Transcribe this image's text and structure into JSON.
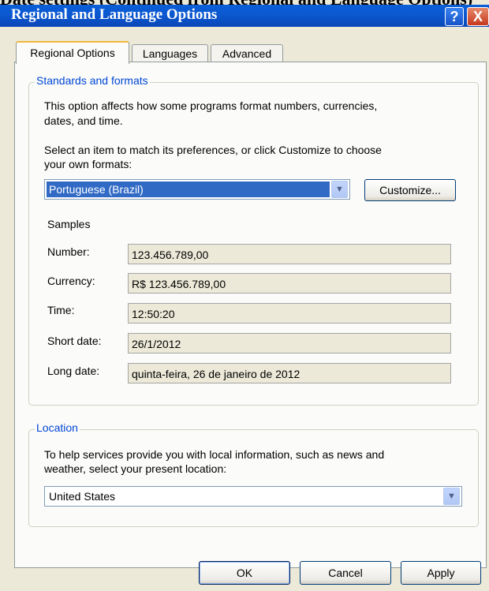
{
  "window": {
    "title": "Regional and Language Options",
    "background_text": "Date settings (Continued from Regional and Language Options)",
    "help_glyph": "?",
    "close_glyph": "X"
  },
  "tabs": [
    {
      "label": "Regional Options",
      "active": true
    },
    {
      "label": "Languages",
      "active": false
    },
    {
      "label": "Advanced",
      "active": false
    }
  ],
  "standards": {
    "legend": "Standards and formats",
    "description_1": "This option affects how some programs format numbers, currencies,",
    "description_2": "dates, and time.",
    "select_prompt_1": "Select an item to match its preferences, or click Customize to choose",
    "select_prompt_2": "your own formats:",
    "selected_format": "Portuguese (Brazil)",
    "customize_label": "Customize...",
    "samples_heading": "Samples",
    "samples": [
      {
        "label": "Number:",
        "value": "123.456.789,00"
      },
      {
        "label": "Currency:",
        "value": "R$ 123.456.789,00"
      },
      {
        "label": "Time:",
        "value": "12:50:20"
      },
      {
        "label": "Short date:",
        "value": "26/1/2012"
      },
      {
        "label": "Long date:",
        "value": "quinta-feira, 26 de janeiro de 2012"
      }
    ]
  },
  "location": {
    "legend": "Location",
    "description_1": "To help services provide you with local information, such as news and",
    "description_2": "weather, select your present location:",
    "selected_location": "United States"
  },
  "buttons": {
    "ok": "OK",
    "cancel": "Cancel",
    "apply": "Apply"
  },
  "colors": {
    "titlebar": "#0a5fd8",
    "legend_text": "#0046d5",
    "selection": "#316ac5",
    "active_tab_accent": "#f2b73c"
  }
}
